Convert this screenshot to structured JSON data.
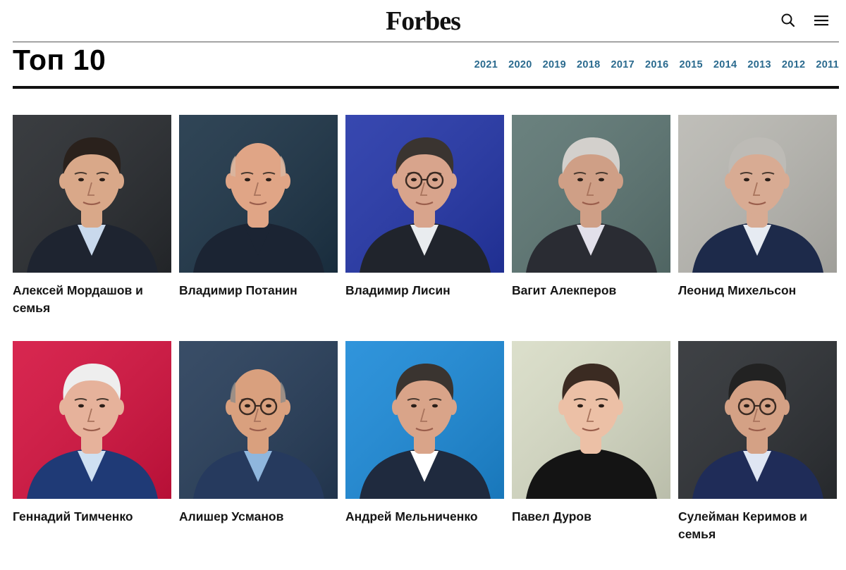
{
  "header": {
    "logo": "Forbes",
    "search_icon": "search-icon",
    "menu_icon": "hamburger-menu-icon"
  },
  "page": {
    "title": "Топ 10",
    "years": [
      "2021",
      "2020",
      "2019",
      "2018",
      "2017",
      "2016",
      "2015",
      "2014",
      "2013",
      "2012",
      "2011"
    ]
  },
  "people": [
    {
      "name": "Алексей Мордашов и семья",
      "bg": "#272a2e",
      "skin": "#d9a889",
      "hair": "#2a211c",
      "suit": "#1e2430",
      "shirt": "#c9d9ec",
      "glasses": false,
      "bald": false
    },
    {
      "name": "Владимир Потанин",
      "bg": "#1c3346",
      "skin": "#e0a586",
      "hair": "#d8b8a3",
      "suit": "#1b2433",
      "shirt": "#1b2433",
      "glasses": false,
      "bald": true
    },
    {
      "name": "Владимир Лисин",
      "bg": "#2436a8",
      "skin": "#d8a48c",
      "hair": "#3a3430",
      "suit": "#20242c",
      "shirt": "#e9ecef",
      "glasses": true,
      "bald": false
    },
    {
      "name": "Вагит Алекперов",
      "bg": "#5c7572",
      "skin": "#cf9f86",
      "hair": "#d3d0cc",
      "suit": "#2a2c33",
      "shirt": "#e2e0ea",
      "glasses": false,
      "bald": false
    },
    {
      "name": "Леонид Михельсон",
      "bg": "#b9b8b2",
      "skin": "#d8ab93",
      "hair": "#bdbbb6",
      "suit": "#1d2a4a",
      "shirt": "#e6ebf2",
      "glasses": false,
      "bald": false
    },
    {
      "name": "Геннадий Тимченко",
      "bg": "#d4123f",
      "skin": "#e6b29b",
      "hair": "#eeeeee",
      "suit": "#1f3a76",
      "shirt": "#cfe0f2",
      "glasses": false,
      "bald": false
    },
    {
      "name": "Алишер Усманов",
      "bg": "#263c58",
      "skin": "#d9a07e",
      "hair": "#8d8b88",
      "suit": "#263a5e",
      "shirt": "#8fb6dd",
      "glasses": true,
      "bald": true
    },
    {
      "name": "Андрей Мельниченко",
      "bg": "#1c8ad8",
      "skin": "#d9a489",
      "hair": "#3a3430",
      "suit": "#1f2a3e",
      "shirt": "#ffffff",
      "glasses": false,
      "bald": false
    },
    {
      "name": "Павел Дуров",
      "bg": "#d8dcc6",
      "skin": "#ecc0a6",
      "hair": "#3b2b22",
      "suit": "#141414",
      "shirt": "#141414",
      "glasses": false,
      "bald": false
    },
    {
      "name": "Сулейман Керимов и семья",
      "bg": "#2c2f33",
      "skin": "#d4a185",
      "hair": "#222222",
      "suit": "#1f2c58",
      "shirt": "#dfe6f3",
      "glasses": true,
      "bald": false
    }
  ]
}
